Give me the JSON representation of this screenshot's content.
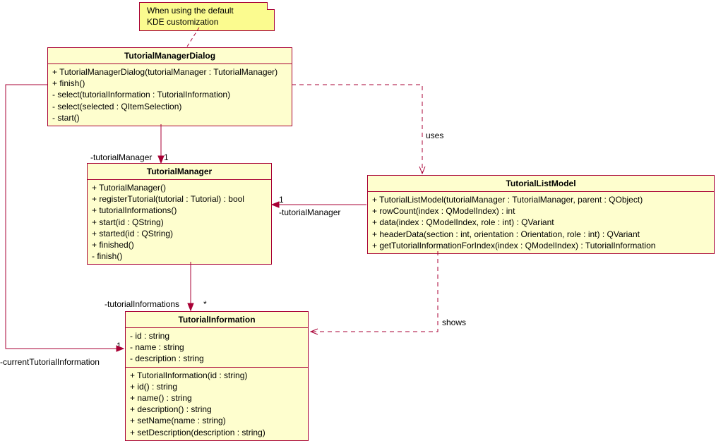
{
  "note": {
    "line1": "When using the default",
    "line2": "KDE customization"
  },
  "classes": {
    "TutorialManagerDialog": {
      "name": "TutorialManagerDialog",
      "members": [
        "+ TutorialManagerDialog(tutorialManager : TutorialManager)",
        "+ finish()",
        "- select(tutorialInformation : TutorialInformation)",
        "- select(selected : QItemSelection)",
        "- start()"
      ]
    },
    "TutorialManager": {
      "name": "TutorialManager",
      "members": [
        "+ TutorialManager()",
        "+ registerTutorial(tutorial : Tutorial) : bool",
        "+ tutorialInformations()",
        "+ start(id : QString)",
        "+ started(id : QString)",
        "+ finished()",
        "- finish()"
      ]
    },
    "TutorialListModel": {
      "name": "TutorialListModel",
      "members": [
        "+ TutorialListModel(tutorialManager : TutorialManager, parent : QObject)",
        "+ rowCount(index : QModelIndex) : int",
        "+ data(index : QModelIndex, role : int) : QVariant",
        "+ headerData(section : int, orientation : Orientation, role : int) : QVariant",
        "+ getTutorialInformationForIndex(index : QModelIndex) : TutorialInformation"
      ]
    },
    "TutorialInformation": {
      "name": "TutorialInformation",
      "attributes": [
        "- id : string",
        "- name : string",
        "- description : string"
      ],
      "members": [
        "+ TutorialInformation(id : string)",
        "+ id() : string",
        "+ name() : string",
        "+ description() : string",
        "+ setName(name : string)",
        "+ setDescription(description : string)"
      ]
    }
  },
  "relations": {
    "uses": "uses",
    "shows": "shows",
    "tutorialManager": "-tutorialManager",
    "tutorialInformations": "-tutorialInformations",
    "currentTutorialInformation": "-currentTutorialInformation",
    "mult_1a": "1",
    "mult_1b": "1",
    "mult_1c": "1",
    "mult_star": "*"
  }
}
